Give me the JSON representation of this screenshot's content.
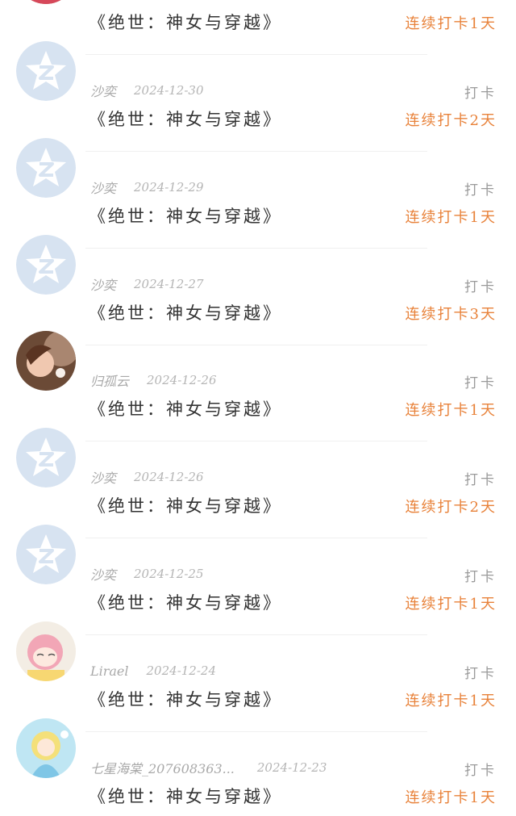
{
  "checkins": [
    {
      "user": "",
      "date": "",
      "book": "《绝世：神女与穿越》",
      "type": "",
      "streak": "连续打卡1天",
      "avatar": "photo-warm"
    },
    {
      "user": "沙奕",
      "date": "2024-12-30",
      "book": "《绝世：神女与穿越》",
      "type": "打卡",
      "streak": "连续打卡2天",
      "avatar": "default-star"
    },
    {
      "user": "沙奕",
      "date": "2024-12-29",
      "book": "《绝世：神女与穿越》",
      "type": "打卡",
      "streak": "连续打卡1天",
      "avatar": "default-star"
    },
    {
      "user": "沙奕",
      "date": "2024-12-27",
      "book": "《绝世：神女与穿越》",
      "type": "打卡",
      "streak": "连续打卡3天",
      "avatar": "default-star"
    },
    {
      "user": "归孤云",
      "date": "2024-12-26",
      "book": "《绝世：神女与穿越》",
      "type": "打卡",
      "streak": "连续打卡1天",
      "avatar": "photo-girl"
    },
    {
      "user": "沙奕",
      "date": "2024-12-26",
      "book": "《绝世：神女与穿越》",
      "type": "打卡",
      "streak": "连续打卡2天",
      "avatar": "default-star"
    },
    {
      "user": "沙奕",
      "date": "2024-12-25",
      "book": "《绝世：神女与穿越》",
      "type": "打卡",
      "streak": "连续打卡1天",
      "avatar": "default-star"
    },
    {
      "user": "Lirael",
      "date": "2024-12-24",
      "book": "《绝世：神女与穿越》",
      "type": "打卡",
      "streak": "连续打卡1天",
      "avatar": "anime-pink"
    },
    {
      "user": "七星海棠_207608363...",
      "date": "2024-12-23",
      "book": "《绝世：神女与穿越》",
      "type": "打卡",
      "streak": "连续打卡1天",
      "avatar": "anime-blue"
    }
  ]
}
